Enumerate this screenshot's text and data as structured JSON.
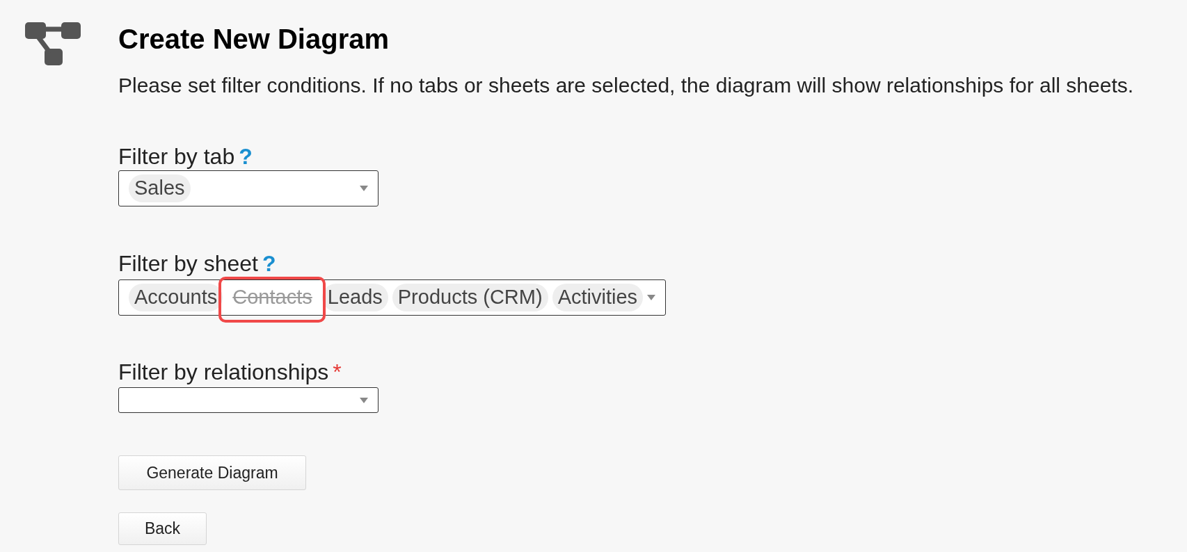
{
  "title": "Create New Diagram",
  "description": "Please set filter conditions. If no tabs or sheets are selected, the diagram will show relationships for all sheets.",
  "filters": [
    {
      "label": "Filter by tab",
      "help": "?",
      "required": false,
      "tags": [
        {
          "text": "Sales",
          "removed": false
        }
      ]
    },
    {
      "label": "Filter by sheet",
      "help": "?",
      "required": false,
      "tags": [
        {
          "text": "Accounts",
          "removed": false
        },
        {
          "text": "Contacts",
          "removed": true
        },
        {
          "text": "Leads",
          "removed": false
        },
        {
          "text": "Products (CRM)",
          "removed": false
        },
        {
          "text": "Activities",
          "removed": false
        }
      ]
    },
    {
      "label": "Filter by relationships",
      "required": true,
      "required_mark": "*"
    }
  ],
  "buttons": [
    {
      "label": "Generate Diagram"
    },
    {
      "label": "Back"
    }
  ]
}
